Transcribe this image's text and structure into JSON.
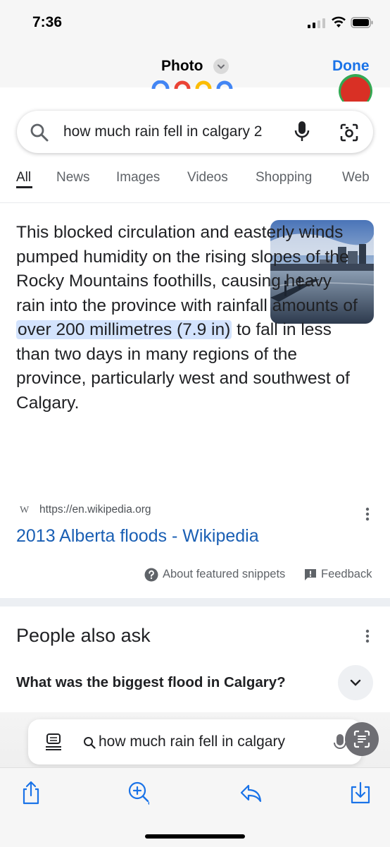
{
  "status": {
    "time": "7:36"
  },
  "nav": {
    "title": "Photo",
    "done_label": "Done"
  },
  "search": {
    "query": "how much rain fell in calgary 2"
  },
  "tabs": [
    {
      "label": "All",
      "active": true
    },
    {
      "label": "News"
    },
    {
      "label": "Images"
    },
    {
      "label": "Videos"
    },
    {
      "label": "Shopping"
    },
    {
      "label": "Web"
    }
  ],
  "snippet": {
    "text_before": "This blocked circulation and easterly winds pumped humidity on the rising slopes of the Rocky Mountains foothills, causing heavy rain into the province with rainfall amounts of ",
    "highlight": "over 200 millimetres (7.9 in)",
    "text_after": " to fall in less than two days in many regions of the province, particularly west and southwest of Calgary.",
    "image_alt": "flooded city waterfront"
  },
  "source": {
    "favicon": "W",
    "url": "https://en.wikipedia.org",
    "title": "2013 Alberta floods - Wikipedia"
  },
  "snippet_footer": {
    "about_label": "About featured snippets",
    "feedback_label": "Feedback"
  },
  "people_also_ask": {
    "title": "People also ask",
    "questions": [
      "What was the biggest flood in Calgary?"
    ]
  },
  "bottom_bar": {
    "search_text": "how much rain fell in calgary"
  },
  "colors": {
    "accent": "#1a73e8",
    "link": "#1a5fb4",
    "highlight": "#d3e3fd"
  }
}
